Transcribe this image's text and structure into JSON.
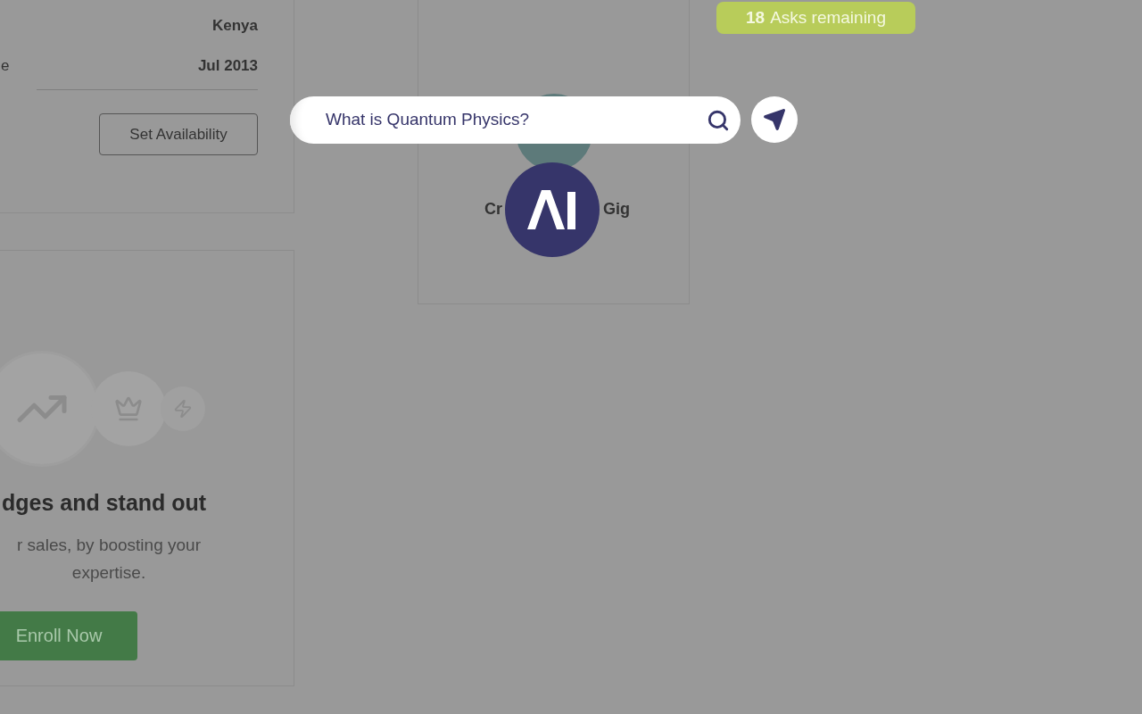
{
  "profile_card": {
    "rows": [
      {
        "value": "Kenya"
      },
      {
        "label": "e",
        "value": "Jul 2013"
      }
    ],
    "set_availability_button": "Set Availability"
  },
  "badges_card": {
    "title": "dges and stand out",
    "description": "r sales, by boosting your expertise.",
    "enroll_button": "Enroll Now"
  },
  "gig_card": {
    "label_start": "Cr",
    "label_end": "Gig"
  },
  "ai_assistant": {
    "asks_count": "18",
    "asks_label": "Asks remaining",
    "search_value": "What is Quantum Physics?"
  }
}
